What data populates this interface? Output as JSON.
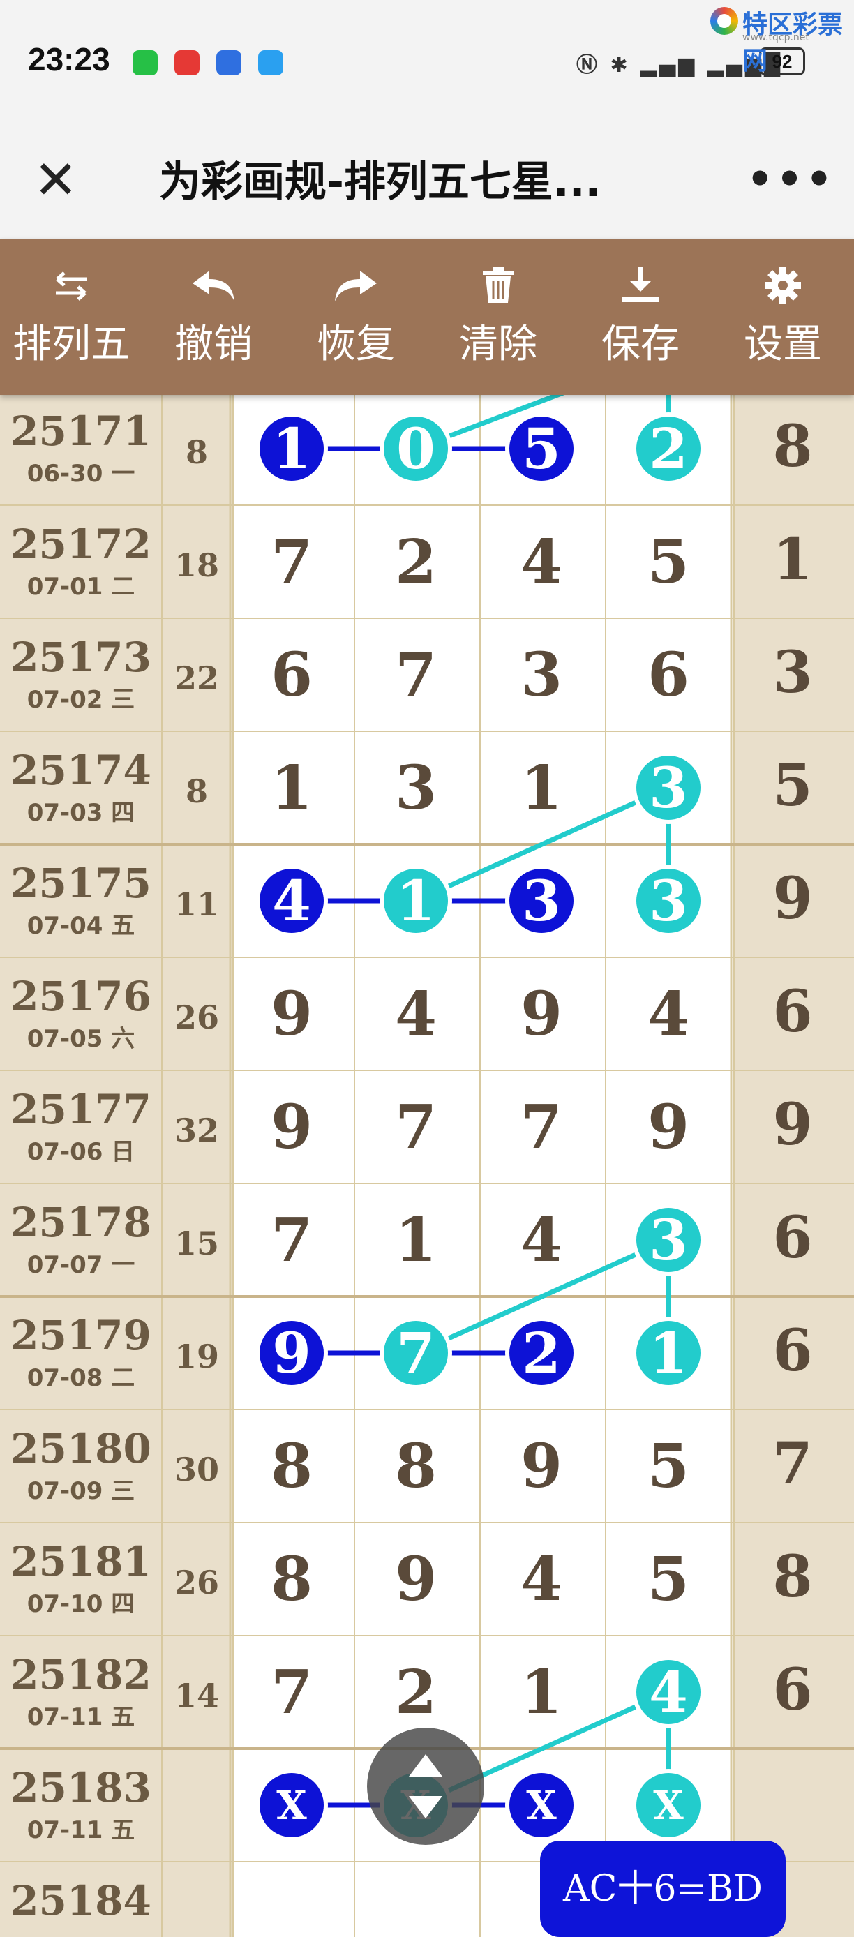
{
  "status": {
    "time": "23:23",
    "battery": "92"
  },
  "watermark": {
    "name": "特区彩票网",
    "url": "www.tqcp.net"
  },
  "header": {
    "title": "为彩画规-排列五七星..."
  },
  "toolbar": [
    {
      "label": "排列五",
      "icon": "swap-icon"
    },
    {
      "label": "撤销",
      "icon": "undo-icon"
    },
    {
      "label": "恢复",
      "icon": "redo-icon"
    },
    {
      "label": "清除",
      "icon": "trash-icon"
    },
    {
      "label": "保存",
      "icon": "download-icon"
    },
    {
      "label": "设置",
      "icon": "gear-icon"
    }
  ],
  "colors": {
    "dark_blue": "#0d12d6",
    "teal": "#22cccc",
    "toolbar": "#9c7457",
    "grid_line": "#d8c9a0"
  },
  "rows": [
    {
      "issue": "25171",
      "date": "06-30 一",
      "sum": "8",
      "digits": [
        "1",
        "0",
        "5",
        "2"
      ],
      "last": "8"
    },
    {
      "issue": "25172",
      "date": "07-01 二",
      "sum": "18",
      "digits": [
        "7",
        "2",
        "4",
        "5"
      ],
      "last": "1"
    },
    {
      "issue": "25173",
      "date": "07-02 三",
      "sum": "22",
      "digits": [
        "6",
        "7",
        "3",
        "6"
      ],
      "last": "3"
    },
    {
      "issue": "25174",
      "date": "07-03 四",
      "sum": "8",
      "digits": [
        "1",
        "3",
        "1",
        "3"
      ],
      "last": "5"
    },
    {
      "issue": "25175",
      "date": "07-04 五",
      "sum": "11",
      "digits": [
        "4",
        "1",
        "3",
        "3"
      ],
      "last": "9"
    },
    {
      "issue": "25176",
      "date": "07-05 六",
      "sum": "26",
      "digits": [
        "9",
        "4",
        "9",
        "4"
      ],
      "last": "6"
    },
    {
      "issue": "25177",
      "date": "07-06 日",
      "sum": "32",
      "digits": [
        "9",
        "7",
        "7",
        "9"
      ],
      "last": "9"
    },
    {
      "issue": "25178",
      "date": "07-07 一",
      "sum": "15",
      "digits": [
        "7",
        "1",
        "4",
        "3"
      ],
      "last": "6"
    },
    {
      "issue": "25179",
      "date": "07-08 二",
      "sum": "19",
      "digits": [
        "9",
        "7",
        "2",
        "1"
      ],
      "last": "6"
    },
    {
      "issue": "25180",
      "date": "07-09 三",
      "sum": "30",
      "digits": [
        "8",
        "8",
        "9",
        "5"
      ],
      "last": "7"
    },
    {
      "issue": "25181",
      "date": "07-10 四",
      "sum": "26",
      "digits": [
        "8",
        "9",
        "4",
        "5"
      ],
      "last": "8"
    },
    {
      "issue": "25182",
      "date": "07-11 五",
      "sum": "14",
      "digits": [
        "7",
        "2",
        "1",
        "4"
      ],
      "last": "6"
    },
    {
      "issue": "25183",
      "date": "07-11 五",
      "sum": "",
      "digits": [
        "X",
        "X",
        "X",
        "X"
      ],
      "last": ""
    },
    {
      "issue": "25184",
      "date": "",
      "sum": "",
      "digits": [
        "",
        "",
        "",
        ""
      ],
      "last": ""
    }
  ],
  "marks": [
    {
      "row": 0,
      "col": 0,
      "style": "dark"
    },
    {
      "row": 0,
      "col": 1,
      "style": "teal"
    },
    {
      "row": 0,
      "col": 2,
      "style": "dark"
    },
    {
      "row": 0,
      "col": 3,
      "style": "teal"
    },
    {
      "row": 3,
      "col": 3,
      "style": "teal"
    },
    {
      "row": 4,
      "col": 0,
      "style": "dark"
    },
    {
      "row": 4,
      "col": 1,
      "style": "teal"
    },
    {
      "row": 4,
      "col": 2,
      "style": "dark"
    },
    {
      "row": 4,
      "col": 3,
      "style": "teal"
    },
    {
      "row": 7,
      "col": 3,
      "style": "teal"
    },
    {
      "row": 8,
      "col": 0,
      "style": "dark"
    },
    {
      "row": 8,
      "col": 1,
      "style": "teal"
    },
    {
      "row": 8,
      "col": 2,
      "style": "dark"
    },
    {
      "row": 8,
      "col": 3,
      "style": "teal"
    },
    {
      "row": 11,
      "col": 3,
      "style": "teal"
    },
    {
      "row": 12,
      "col": 0,
      "style": "dark"
    },
    {
      "row": 12,
      "col": 1,
      "style": "teal"
    },
    {
      "row": 12,
      "col": 2,
      "style": "dark"
    },
    {
      "row": 12,
      "col": 3,
      "style": "teal"
    }
  ],
  "links": [
    {
      "from": [
        0,
        0
      ],
      "to": [
        0,
        1
      ],
      "style": "dark"
    },
    {
      "from": [
        0,
        1
      ],
      "to": [
        0,
        2
      ],
      "style": "dark"
    },
    {
      "from": [
        4,
        0
      ],
      "to": [
        4,
        1
      ],
      "style": "dark"
    },
    {
      "from": [
        4,
        1
      ],
      "to": [
        4,
        2
      ],
      "style": "dark"
    },
    {
      "from": [
        8,
        0
      ],
      "to": [
        8,
        1
      ],
      "style": "dark"
    },
    {
      "from": [
        8,
        1
      ],
      "to": [
        8,
        2
      ],
      "style": "dark"
    },
    {
      "from": [
        12,
        0
      ],
      "to": [
        12,
        1
      ],
      "style": "dark"
    },
    {
      "from": [
        12,
        1
      ],
      "to": [
        12,
        2
      ],
      "style": "dark"
    },
    {
      "from": [
        3,
        3
      ],
      "to": [
        4,
        1
      ],
      "style": "teal"
    },
    {
      "from": [
        3,
        3
      ],
      "to": [
        4,
        3
      ],
      "style": "teal"
    },
    {
      "from": [
        7,
        3
      ],
      "to": [
        8,
        1
      ],
      "style": "teal"
    },
    {
      "from": [
        7,
        3
      ],
      "to": [
        8,
        3
      ],
      "style": "teal"
    },
    {
      "from": [
        11,
        3
      ],
      "to": [
        12,
        1
      ],
      "style": "teal"
    },
    {
      "from": [
        11,
        3
      ],
      "to": [
        12,
        3
      ],
      "style": "teal"
    }
  ],
  "floating": {
    "ac_label": "AC十6=BD"
  }
}
